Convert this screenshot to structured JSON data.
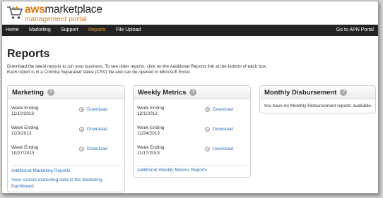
{
  "header": {
    "logo_brand": "aws",
    "logo_word": "marketplace",
    "logo_sub": "management portal"
  },
  "nav": {
    "items": [
      {
        "label": "Home"
      },
      {
        "label": "Marketing"
      },
      {
        "label": "Support"
      },
      {
        "label": "Reports",
        "active": true
      },
      {
        "label": "File Upload"
      }
    ],
    "right_link": "Go to APN Portal"
  },
  "page": {
    "title": "Reports",
    "intro_line1": "Download the latest reports to run your business. To see older reports, click on the Additional Reports link at the bottom of each box.",
    "intro_line2": "Each report is in a Comma Separated Value (CSV) file and can be opened in Microsoft Excel."
  },
  "boxes": {
    "marketing": {
      "title": "Marketing",
      "rows": [
        {
          "label": "Week Ending",
          "date": "11/10/2013",
          "download": "Download"
        },
        {
          "label": "Week Ending",
          "date": "11/3/2013",
          "download": "Download"
        },
        {
          "label": "Week Ending",
          "date": "10/27/2013",
          "download": "Download"
        }
      ],
      "additional_link": "Additional Marketing Reports",
      "dashboard_link_line1": "View current marketing data in the Marketing",
      "dashboard_link_line2": "Dashboard"
    },
    "weekly": {
      "title": "Weekly Metrics",
      "rows": [
        {
          "label": "Week Ending",
          "date": "12/1/2013",
          "download": "Download"
        },
        {
          "label": "Week Ending",
          "date": "11/24/2013",
          "download": "Download"
        },
        {
          "label": "Week Ending",
          "date": "11/17/2013",
          "download": "Download"
        }
      ],
      "additional_link": "Additional Weekly Metrics Reports"
    },
    "monthly": {
      "title": "Monthly Disbursement",
      "empty_message": "You have no Monthly Disbursement reports available."
    }
  },
  "colors": {
    "accent": "#e47911",
    "nav_bg": "#232323",
    "nav_active": "#f0a030",
    "link": "#2a6fb5"
  }
}
